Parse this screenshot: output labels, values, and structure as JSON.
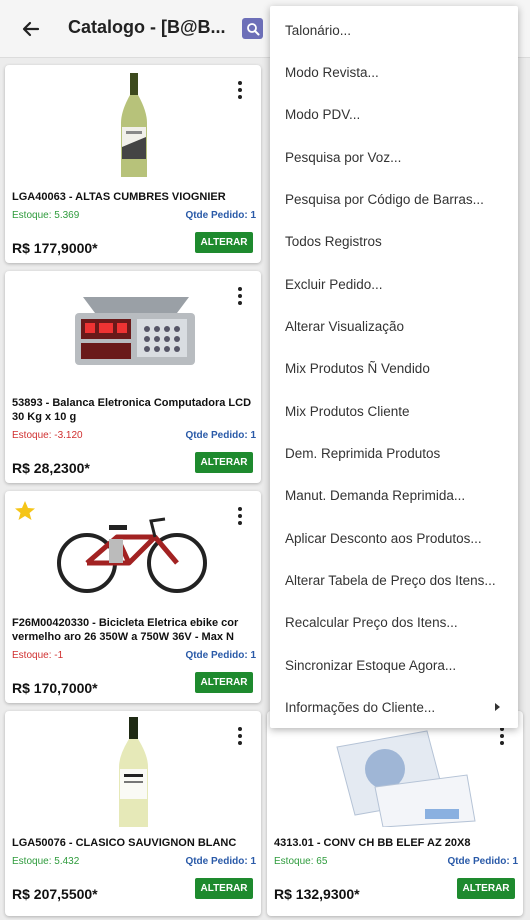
{
  "appbar": {
    "title": "Catalogo - [B@B...",
    "back_icon": "arrow-left-icon",
    "search_icon": "search-icon"
  },
  "colors": {
    "alter_button": "#1e8a2e",
    "stock_positive": "#2e9b3c",
    "stock_negative": "#d03030",
    "qty_label": "#2a5aa8",
    "search_button": "#6d6fb8"
  },
  "products": [
    {
      "name": "LGA40063 - ALTAS CUMBRES VIOGNIER",
      "stock": "Estoque: 5.369",
      "qty": "Qtde Pedido: 1",
      "price": "R$ 177,9000*",
      "button": "ALTERAR",
      "image": "white-wine-bottle"
    },
    {
      "name": "53893 - Balanca Eletronica Computadora LCD 30 Kg x 10 g",
      "stock": "Estoque: -3.120",
      "qty": "Qtde Pedido: 1",
      "price": "R$ 28,2300*",
      "button": "ALTERAR",
      "image": "digital-scale"
    },
    {
      "name": "F26M00420330 - Bicicleta Eletrica ebike cor vermelho aro 26 350W a 750W 36V - Max N",
      "stock": "Estoque: -1",
      "qty": "Qtde Pedido: 1",
      "price": "R$ 170,7000*",
      "button": "ALTERAR",
      "image": "electric-bicycle",
      "favorite": true
    },
    {
      "name": "LGA50076 - CLASICO SAUVIGNON BLANC",
      "stock": "Estoque: 5.432",
      "qty": "Qtde Pedido: 1",
      "price": "R$ 207,5500*",
      "button": "ALTERAR",
      "image": "white-wine-bottle"
    },
    {
      "name": "4313.01 - CONV CH BB ELEF AZ 20X8",
      "stock": "Estoque: 65",
      "qty": "Qtde Pedido: 1",
      "price": "R$ 132,9300*",
      "button": "ALTERAR",
      "image": "baby-shower-invitation"
    }
  ],
  "menu": {
    "items": [
      "Talonário...",
      "Modo Revista...",
      "Modo PDV...",
      "Pesquisa por Voz...",
      "Pesquisa por Código de Barras...",
      "Todos Registros",
      "Excluir Pedido...",
      "Alterar Visualização",
      "Mix Produtos Ñ Vendido",
      "Mix Produtos Cliente",
      "Dem. Reprimida Produtos",
      "Manut. Demanda Reprimida...",
      "Aplicar Desconto aos Produtos...",
      "Alterar Tabela de Preço dos Itens...",
      "Recalcular Preço dos Itens...",
      "Sincronizar Estoque Agora...",
      "Informações do Cliente..."
    ]
  }
}
